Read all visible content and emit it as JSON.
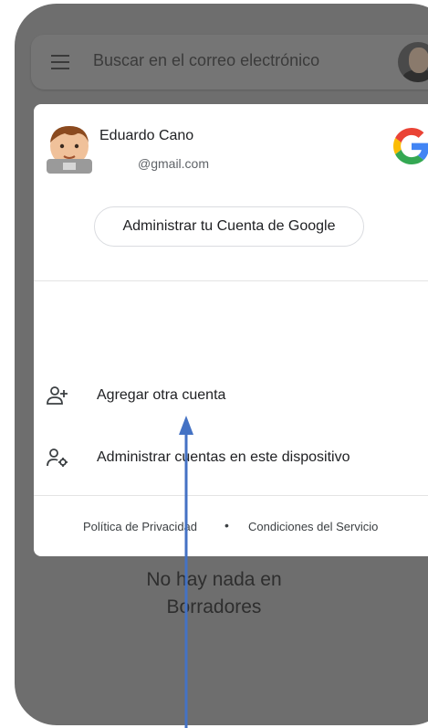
{
  "search": {
    "placeholder": "Buscar en el correo electrónico"
  },
  "account": {
    "name": "Eduardo Cano",
    "email": "@gmail.com",
    "manage_button": "Administrar tu Cuenta de Google"
  },
  "menu": {
    "items": [
      {
        "label": "Agregar otra cuenta",
        "icon": "add-person-icon"
      },
      {
        "label": "Administrar cuentas en este dispositivo",
        "icon": "manage-accounts-icon"
      }
    ]
  },
  "footer": {
    "privacy": "Política de Privacidad",
    "separator": "•",
    "terms": "Condiciones del Servicio"
  },
  "empty_state": {
    "line1": "No hay nada en",
    "line2": "Borradores"
  },
  "annotation": {
    "arrow_color": "#4472c4"
  },
  "colors": {
    "overlay_background": "#6e6e6e",
    "card_background": "#ffffff",
    "google_blue": "#4285F4",
    "google_red": "#EA4335",
    "google_yellow": "#FBBC05",
    "google_green": "#34A853"
  }
}
